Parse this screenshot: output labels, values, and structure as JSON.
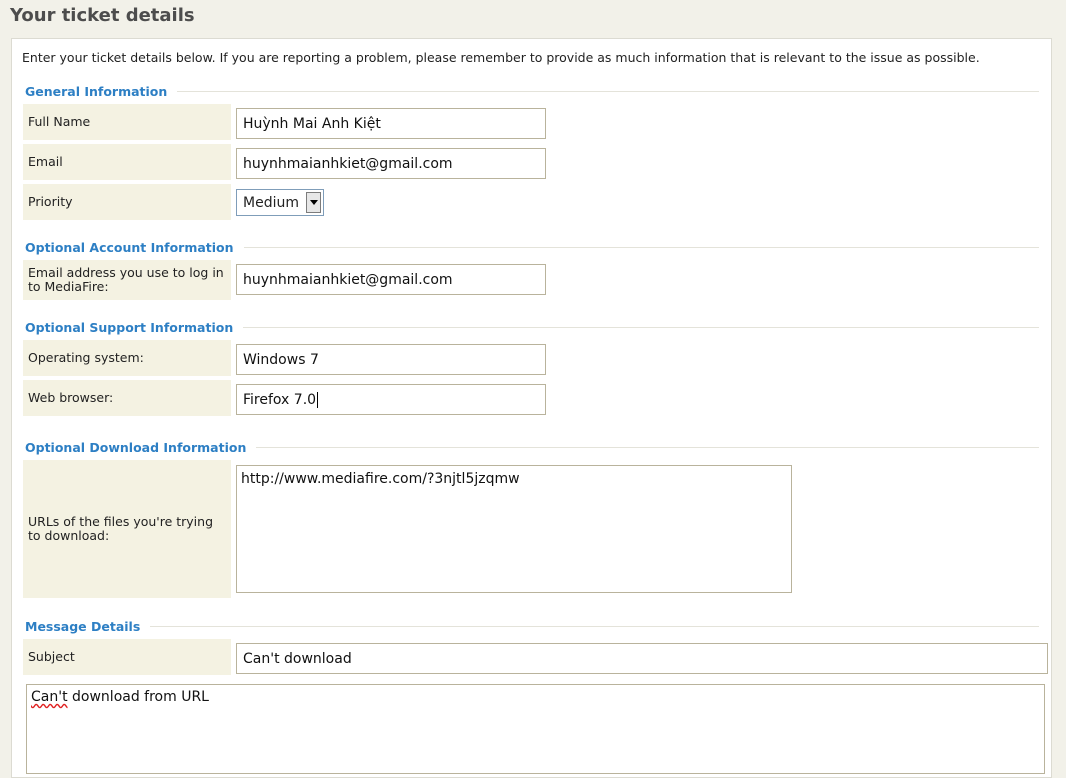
{
  "page": {
    "title": "Your ticket details"
  },
  "intro": "Enter your ticket details below. If you are reporting a problem, please remember to provide as much information that is relevant to the issue as possible.",
  "sections": {
    "general": "General Information",
    "account": "Optional Account Information",
    "support": "Optional Support Information",
    "download": "Optional Download Information",
    "message": "Message Details"
  },
  "fields": {
    "full_name": {
      "label": "Full Name",
      "value": "Huỳnh Mai Anh Kiệt"
    },
    "email": {
      "label": "Email",
      "value": "huynhmaianhkiet@gmail.com"
    },
    "priority": {
      "label": "Priority",
      "value": "Medium"
    },
    "login_email": {
      "label": "Email address you use to log in to MediaFire:",
      "value": "huynhmaianhkiet@gmail.com"
    },
    "os": {
      "label": "Operating system:",
      "value": "Windows 7"
    },
    "browser": {
      "label": "Web browser:",
      "value": "Firefox 7.0"
    },
    "urls": {
      "label": "URLs of the files you're trying to download:",
      "value": "http://www.mediafire.com/?3njtl5jzqmw"
    },
    "subject": {
      "label": "Subject",
      "value": "Can't download"
    },
    "message": {
      "word_underlined": "Can't",
      "rest": " download from URL"
    }
  }
}
